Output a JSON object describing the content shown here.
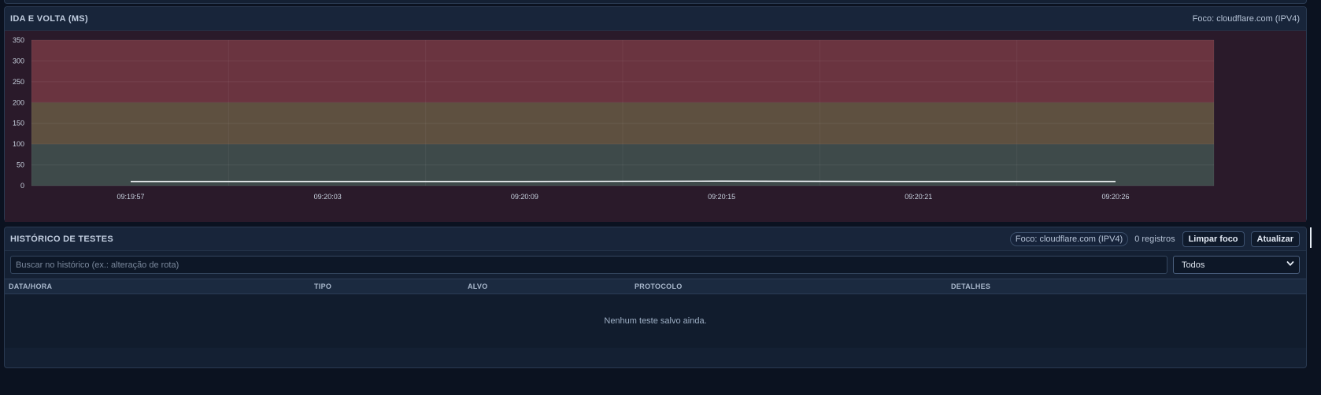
{
  "chart_panel": {
    "title": "IDA E VOLTA (MS)",
    "focus_label": "Foco: cloudflare.com (IPV4)"
  },
  "chart_data": {
    "type": "line",
    "title": "IDA E VOLTA (MS)",
    "xlabel": "",
    "ylabel": "",
    "ylim": [
      0,
      350
    ],
    "yticks": [
      0,
      50,
      100,
      150,
      200,
      250,
      300,
      350
    ],
    "x": [
      "09:19:57",
      "09:20:03",
      "09:20:09",
      "09:20:15",
      "09:20:21",
      "09:20:26"
    ],
    "series": [
      {
        "values": [
          10,
          10,
          10,
          11,
          10,
          10
        ],
        "color": "#e8ecef"
      }
    ],
    "bands": [
      {
        "from": 0,
        "to": 100,
        "color": "#3e4a4a"
      },
      {
        "from": 100,
        "to": 200,
        "color": "#5e5040"
      },
      {
        "from": 200,
        "to": 350,
        "color": "#6a3440"
      }
    ],
    "grid": true
  },
  "history_panel": {
    "title": "HISTÓRICO DE TESTES",
    "focus_pill": "Foco: cloudflare.com (IPV4)",
    "records": "0 registros",
    "clear_focus_label": "Limpar foco",
    "refresh_label": "Atualizar",
    "search_placeholder": "Buscar no histórico (ex.: alteração de rota)",
    "filter_selected": "Todos",
    "columns": [
      "DATA/HORA",
      "TIPO",
      "ALVO",
      "PROTOCOLO",
      "DETALHES"
    ],
    "empty_message": "Nenhum teste salvo ainda."
  },
  "icons": {
    "select_chevron": "chevron-down-icon"
  }
}
